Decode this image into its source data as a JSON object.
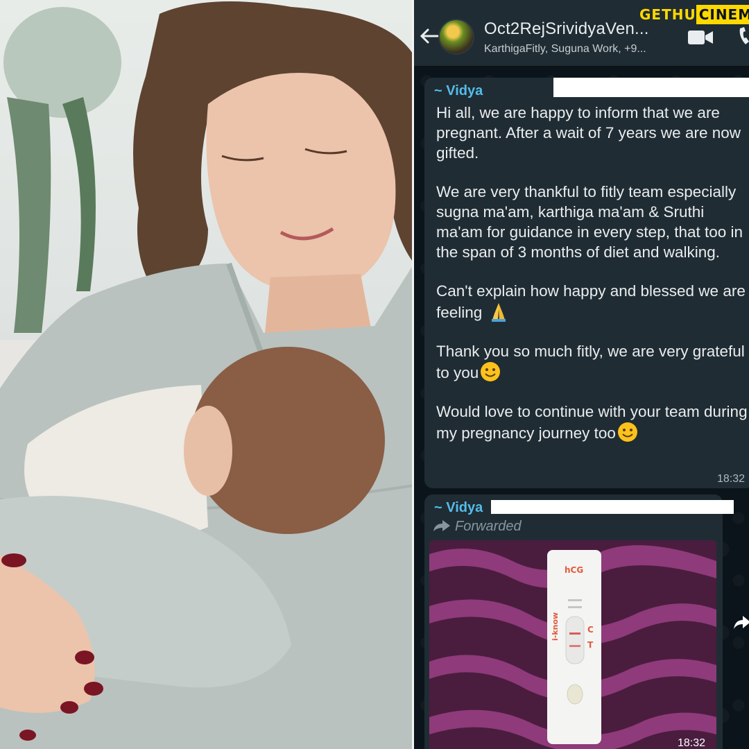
{
  "watermark": {
    "part1": "GETHU",
    "part2": "CINEMA"
  },
  "chat": {
    "group_name": "Oct2RejSrividyaVen...",
    "members": "KarthigaFitly, Suguna Work, +9...",
    "messages": [
      {
        "sender": "~ Vidya",
        "paragraphs": [
          "Hi all, we are happy to inform that we are pregnant. After a wait of 7 years we are now gifted.",
          "We are very thankful to fitly team especially sugna ma'am, karthiga ma'am & Sruthi ma'am for guidance in every step, that too in the span of 3 months of diet and walking.",
          "Can't explain how happy and blessed we are feeling",
          "Thank you so much fitly, we are very grateful to you",
          "Would love to continue with your team during my pregnancy journey too"
        ],
        "emojis": [
          "folded-hands-emoji",
          "smiling-face-emoji",
          "smiling-face-emoji"
        ],
        "time": "18:32"
      },
      {
        "sender": "~ Vidya",
        "forwarded": "Forwarded",
        "image": {
          "test_brand": "i-know",
          "test_label": "hCG",
          "c_mark": "C",
          "t_mark": "T"
        },
        "time": "18:32"
      }
    ]
  },
  "colors": {
    "chat_bg": "#0b141a",
    "bubble": "#202c33",
    "sender": "#53bdeb",
    "watermark": "#ffd800"
  }
}
